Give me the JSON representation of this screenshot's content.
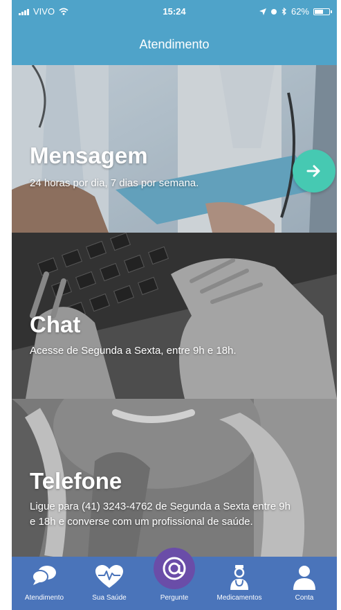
{
  "status_bar": {
    "carrier": "VIVO",
    "time": "15:24",
    "battery_percent": "62%",
    "battery_level": 0.62
  },
  "header": {
    "title": "Atendimento"
  },
  "cards": [
    {
      "title": "Mensagem",
      "description": "24 horas por dia, 7 dias por semana.",
      "action_icon": "arrow-right-icon"
    },
    {
      "title": "Chat",
      "description": "Acesse de Segunda a Sexta, entre 9h e 18h."
    },
    {
      "title": "Telefone",
      "description": "Ligue para (41) 3243-4762 de Segunda a Sexta entre 9h e 18h e converse com um profissional de saúde."
    }
  ],
  "tabs": [
    {
      "label": "Atendimento",
      "icon": "chat-bubbles-icon"
    },
    {
      "label": "Sua Saúde",
      "icon": "heart-pulse-icon"
    },
    {
      "label": "Pergunte",
      "icon": "at-sign-icon"
    },
    {
      "label": "Medicamentos",
      "icon": "doctor-icon"
    },
    {
      "label": "Conta",
      "icon": "person-icon"
    }
  ],
  "colors": {
    "header": "#4fa3c9",
    "tab_bar": "#4a74ba",
    "accent_button": "#46c9b2",
    "pergunte_bubble": "#6a4da8"
  }
}
